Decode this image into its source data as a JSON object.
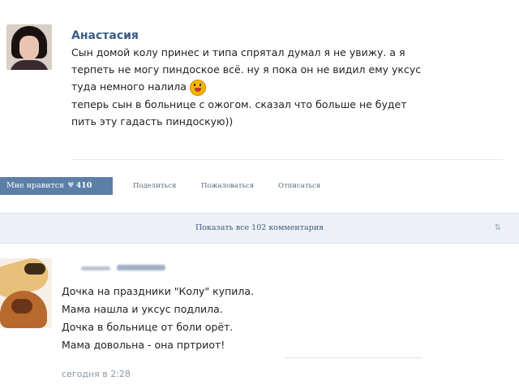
{
  "post": {
    "author": "Анастасия",
    "lines": [
      "Сын домой колу принес и типа спрятал думал я не увижу. а я",
      "терпеть не могу пиндоское всё. ну я пока он не видил ему уксус",
      "туда немного налила",
      "теперь сын в больнице с ожогом. сказал что больше не будет",
      "пить эту гадасть пиндоскую))"
    ],
    "emoji_icon": "shocked-face-emoji"
  },
  "actions": {
    "like_label": "Мне нравится",
    "like_count": "410",
    "share": "Поделиться",
    "report": "Пожаловаться",
    "unsubscribe": "Отписаться"
  },
  "comments_bar": {
    "label": "Показать все 102 комментария",
    "sort_icon": "sort-icon"
  },
  "comment": {
    "lines": [
      "Дочка на праздники \"Колу\" купила.",
      "Мама нашла и уксус подлила.",
      "Дочка в больнице от боли орёт.",
      "Мама довольна - она пртриот!"
    ],
    "timestamp": "сегодня в 2:28"
  },
  "colors": {
    "link": "#3b5d85",
    "like_button": "#5b7fa6",
    "bar_bg": "#edf1f5"
  }
}
